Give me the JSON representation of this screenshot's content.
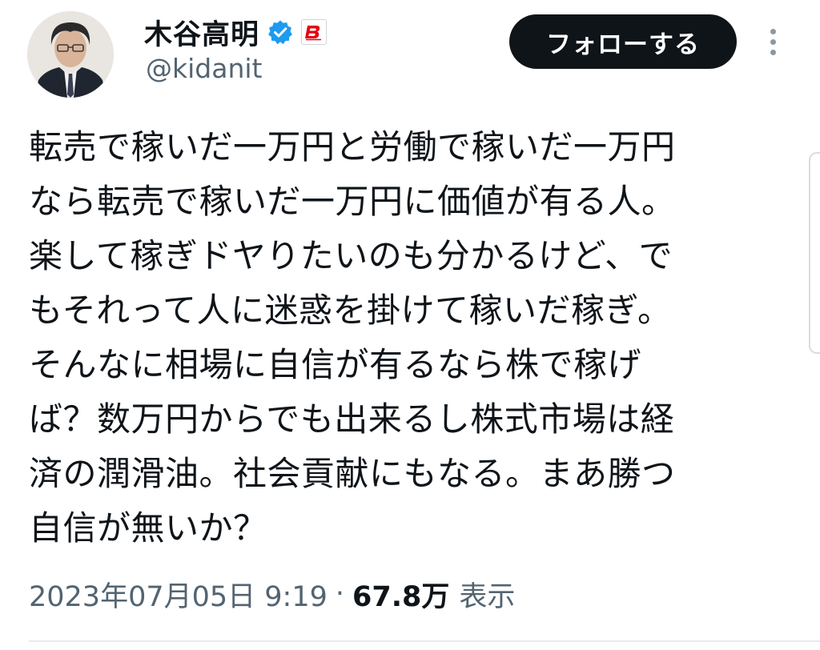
{
  "author": {
    "display_name": "木谷高明",
    "handle": "@kidanit",
    "verified_icon": "verified-badge-icon",
    "brand_icon": "bushiroad-logo-icon",
    "accent_color": "#1d9bf0"
  },
  "actions": {
    "follow_label": "フォローする",
    "more_icon": "more-vertical-icon"
  },
  "tweet": {
    "lines": [
      "転売で稼いだ一万円と労働で稼いだ一万円",
      "なら転売で稼いだ一万円に価値が有る人。",
      "楽して稼ぎドヤりたいのも分かるけど、で",
      "もそれって人に迷惑を掛けて稼いだ稼ぎ。",
      "そんなに相場に自信が有るなら株で稼げ",
      "ば？数万円からでも出来るし株式市場は経",
      "済の潤滑油。社会貢献にもなる。まあ勝つ",
      "自信が無いか？"
    ]
  },
  "meta": {
    "timestamp": "2023年07月05日 9:19",
    "separator": "·",
    "views_count": "67.8万",
    "views_label": "表示"
  }
}
